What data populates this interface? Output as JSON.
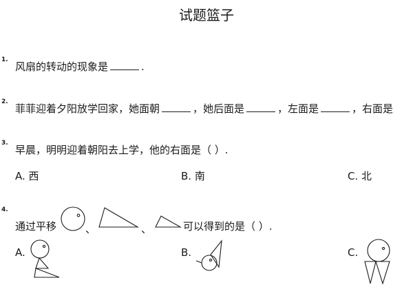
{
  "page": {
    "title": "试题篮子"
  },
  "questions": [
    {
      "number": "1.",
      "parts": [
        "风扇的转动的现象是",
        "."
      ]
    },
    {
      "number": "2.",
      "parts": [
        "菲菲迎着夕阳放学回家，她面朝",
        "，她后面是",
        "，左面是",
        "，右面是"
      ]
    },
    {
      "number": "3.",
      "text": "早晨，明明迎着朝阳去上学，他的右面是（  ）.",
      "options": [
        "A. 西",
        "B. 南",
        "C. 北"
      ]
    },
    {
      "number": "4.",
      "prefix": "通过平移",
      "separator": "、",
      "suffix": "可以得到的是（  ）.",
      "options": [
        "A.",
        "B.",
        "C."
      ]
    }
  ]
}
